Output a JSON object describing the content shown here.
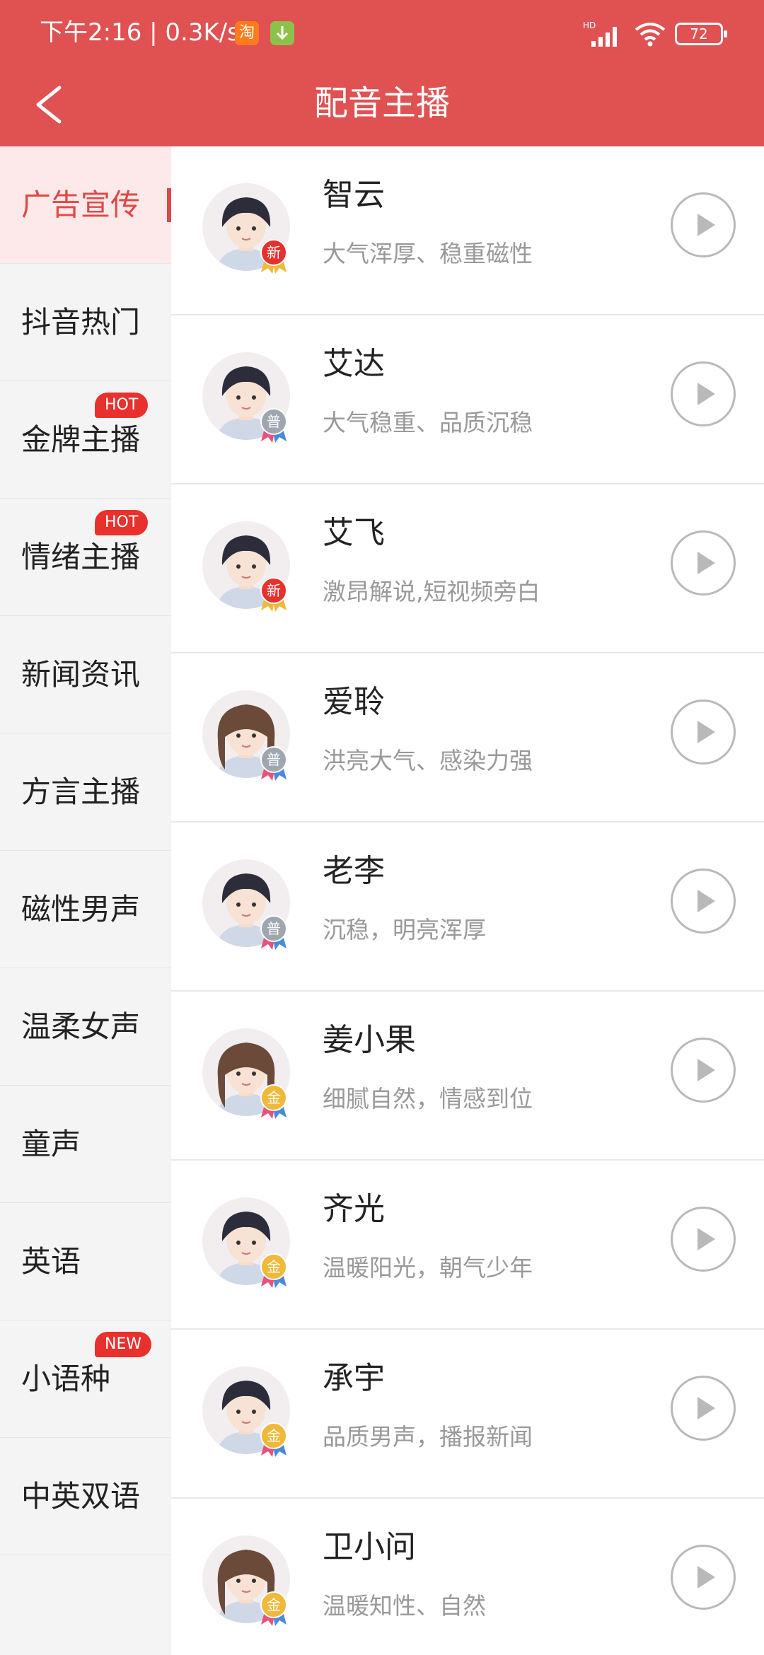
{
  "status_bar": {
    "time_speed": "下午2:16 | 0.3K/s",
    "taobao_label": "淘",
    "signal_label": "HD",
    "battery": "72"
  },
  "header": {
    "title": "配音主播"
  },
  "sidebar": {
    "items": [
      {
        "label": "广告宣传",
        "active": true
      },
      {
        "label": "抖音热门"
      },
      {
        "label": "金牌主播",
        "badge": "HOT"
      },
      {
        "label": "情绪主播",
        "badge": "HOT"
      },
      {
        "label": "新闻资讯"
      },
      {
        "label": "方言主播"
      },
      {
        "label": "磁性男声"
      },
      {
        "label": "温柔女声"
      },
      {
        "label": "童声"
      },
      {
        "label": "英语"
      },
      {
        "label": "小语种",
        "badge": "NEW"
      },
      {
        "label": "中英双语"
      }
    ]
  },
  "anchors": [
    {
      "name": "智云",
      "desc": "大气浑厚、稳重磁性",
      "level": "新",
      "level_color": "#e8302c",
      "avatar_icon": "boy-avatar-icon"
    },
    {
      "name": "艾达",
      "desc": "大气稳重、品质沉稳",
      "level": "普",
      "level_color": "#9fa6b0",
      "avatar_icon": "boy-avatar-icon"
    },
    {
      "name": "艾飞",
      "desc": "激昂解说,短视频旁白",
      "level": "新",
      "level_color": "#e8302c",
      "avatar_icon": "boy-avatar-icon"
    },
    {
      "name": "爱聆",
      "desc": "洪亮大气、感染力强",
      "level": "普",
      "level_color": "#9fa6b0",
      "avatar_icon": "girl-avatar-icon"
    },
    {
      "name": "老李",
      "desc": "沉稳，明亮浑厚",
      "level": "普",
      "level_color": "#9fa6b0",
      "avatar_icon": "man-avatar-icon"
    },
    {
      "name": "姜小果",
      "desc": "细腻自然，情感到位",
      "level": "金",
      "level_color": "#f0b93a",
      "avatar_icon": "girl-avatar-icon"
    },
    {
      "name": "齐光",
      "desc": "温暖阳光，朝气少年",
      "level": "金",
      "level_color": "#f0b93a",
      "avatar_icon": "boy-avatar-icon"
    },
    {
      "name": "承宇",
      "desc": "品质男声，播报新闻",
      "level": "金",
      "level_color": "#f0b93a",
      "avatar_icon": "boy-avatar-icon"
    },
    {
      "name": "卫小问",
      "desc": "温暖知性、自然",
      "level": "金",
      "level_color": "#f0b93a",
      "avatar_icon": "girl-avatar-icon"
    }
  ],
  "colors": {
    "brand": "#e05152",
    "active": "#e04848",
    "badge": "#e8302c"
  }
}
